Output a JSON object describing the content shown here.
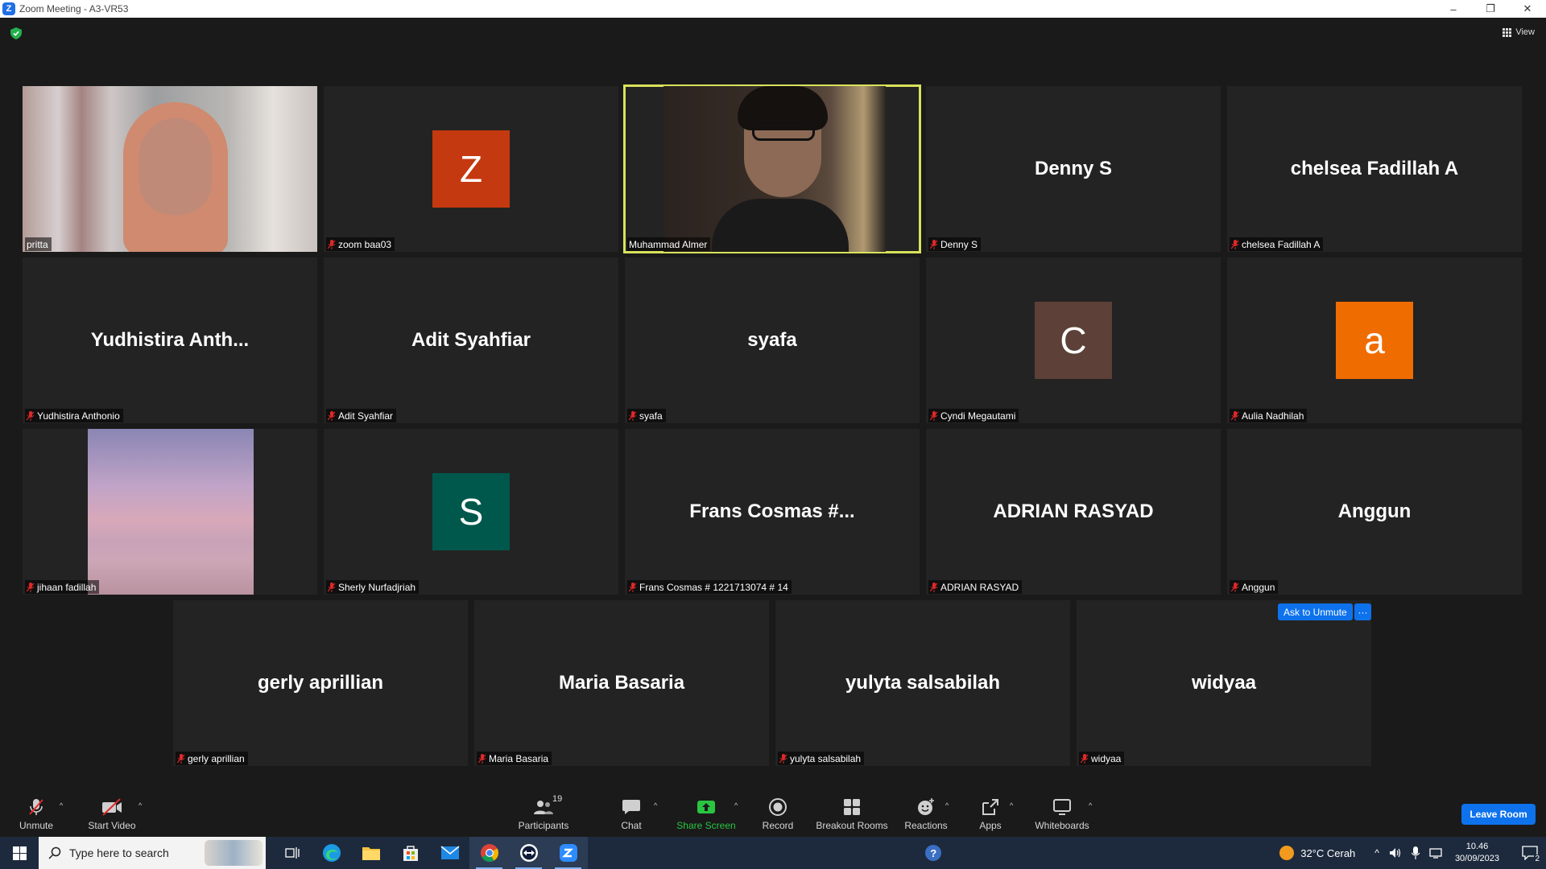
{
  "window": {
    "title": "Zoom Meeting - A3-VR53",
    "minimize": "–",
    "restore": "❐",
    "close": "✕"
  },
  "topbar": {
    "view_label": "View"
  },
  "tiles": [
    {
      "name": "pritta",
      "display": "",
      "muted": false,
      "type": "video"
    },
    {
      "name": "zoom baa03",
      "display": "Z",
      "muted": true,
      "type": "avatar",
      "color": "#c4390f"
    },
    {
      "name": "Muhammad Almer",
      "display": "",
      "muted": false,
      "type": "video",
      "active": true
    },
    {
      "name": "Denny S",
      "display": "Denny S",
      "muted": true,
      "type": "text"
    },
    {
      "name": "chelsea Fadillah A",
      "display": "chelsea Fadillah A",
      "muted": true,
      "type": "text"
    },
    {
      "name": "Yudhistira Anthonio",
      "display": "Yudhistira  Anth...",
      "muted": true,
      "type": "text"
    },
    {
      "name": "Adit Syahfiar",
      "display": "Adit Syahfiar",
      "muted": true,
      "type": "text"
    },
    {
      "name": "syafa",
      "display": "syafa",
      "muted": true,
      "type": "text"
    },
    {
      "name": "Cyndi Megautami",
      "display": "C",
      "muted": true,
      "type": "avatar",
      "color": "#5d4037"
    },
    {
      "name": "Aulia Nadhilah",
      "display": "a",
      "muted": true,
      "type": "avatar",
      "color": "#ef6c00"
    },
    {
      "name": "jihaan fadillah",
      "display": "",
      "muted": true,
      "type": "video"
    },
    {
      "name": "Sherly Nurfadjriah",
      "display": "S",
      "muted": true,
      "type": "avatar",
      "color": "#00574b"
    },
    {
      "name": "Frans Cosmas # 1221713074 # 14",
      "display": "Frans  Cosmas  #...",
      "muted": true,
      "type": "text"
    },
    {
      "name": "ADRIAN RASYAD",
      "display": "ADRIAN RASYAD",
      "muted": true,
      "type": "text"
    },
    {
      "name": "Anggun",
      "display": "Anggun",
      "muted": true,
      "type": "text"
    },
    {
      "name": "gerly aprillian",
      "display": "gerly aprillian",
      "muted": true,
      "type": "text"
    },
    {
      "name": "Maria Basaria",
      "display": "Maria Basaria",
      "muted": true,
      "type": "text"
    },
    {
      "name": "yulyta salsabilah",
      "display": "yulyta salsabilah",
      "muted": true,
      "type": "text"
    },
    {
      "name": "widyaa",
      "display": "widyaa",
      "muted": true,
      "type": "text"
    }
  ],
  "hover_actions": {
    "ask_unmute": "Ask to Unmute",
    "more": "···"
  },
  "toolbar": {
    "unmute": "Unmute",
    "start_video": "Start Video",
    "participants": "Participants",
    "participants_count": "19",
    "chat": "Chat",
    "share_screen": "Share Screen",
    "record": "Record",
    "breakout_rooms": "Breakout Rooms",
    "reactions": "Reactions",
    "apps": "Apps",
    "whiteboards": "Whiteboards",
    "leave": "Leave Room"
  },
  "taskbar": {
    "search_placeholder": "Type here to search",
    "weather": "32°C  Cerah",
    "time": "10.46",
    "date": "30/09/2023",
    "notifications": "2"
  },
  "colors": {
    "accent": "#0e72ed",
    "active_speaker": "#d8e25a",
    "share_green": "#29c541",
    "muted_red": "#e02828"
  }
}
